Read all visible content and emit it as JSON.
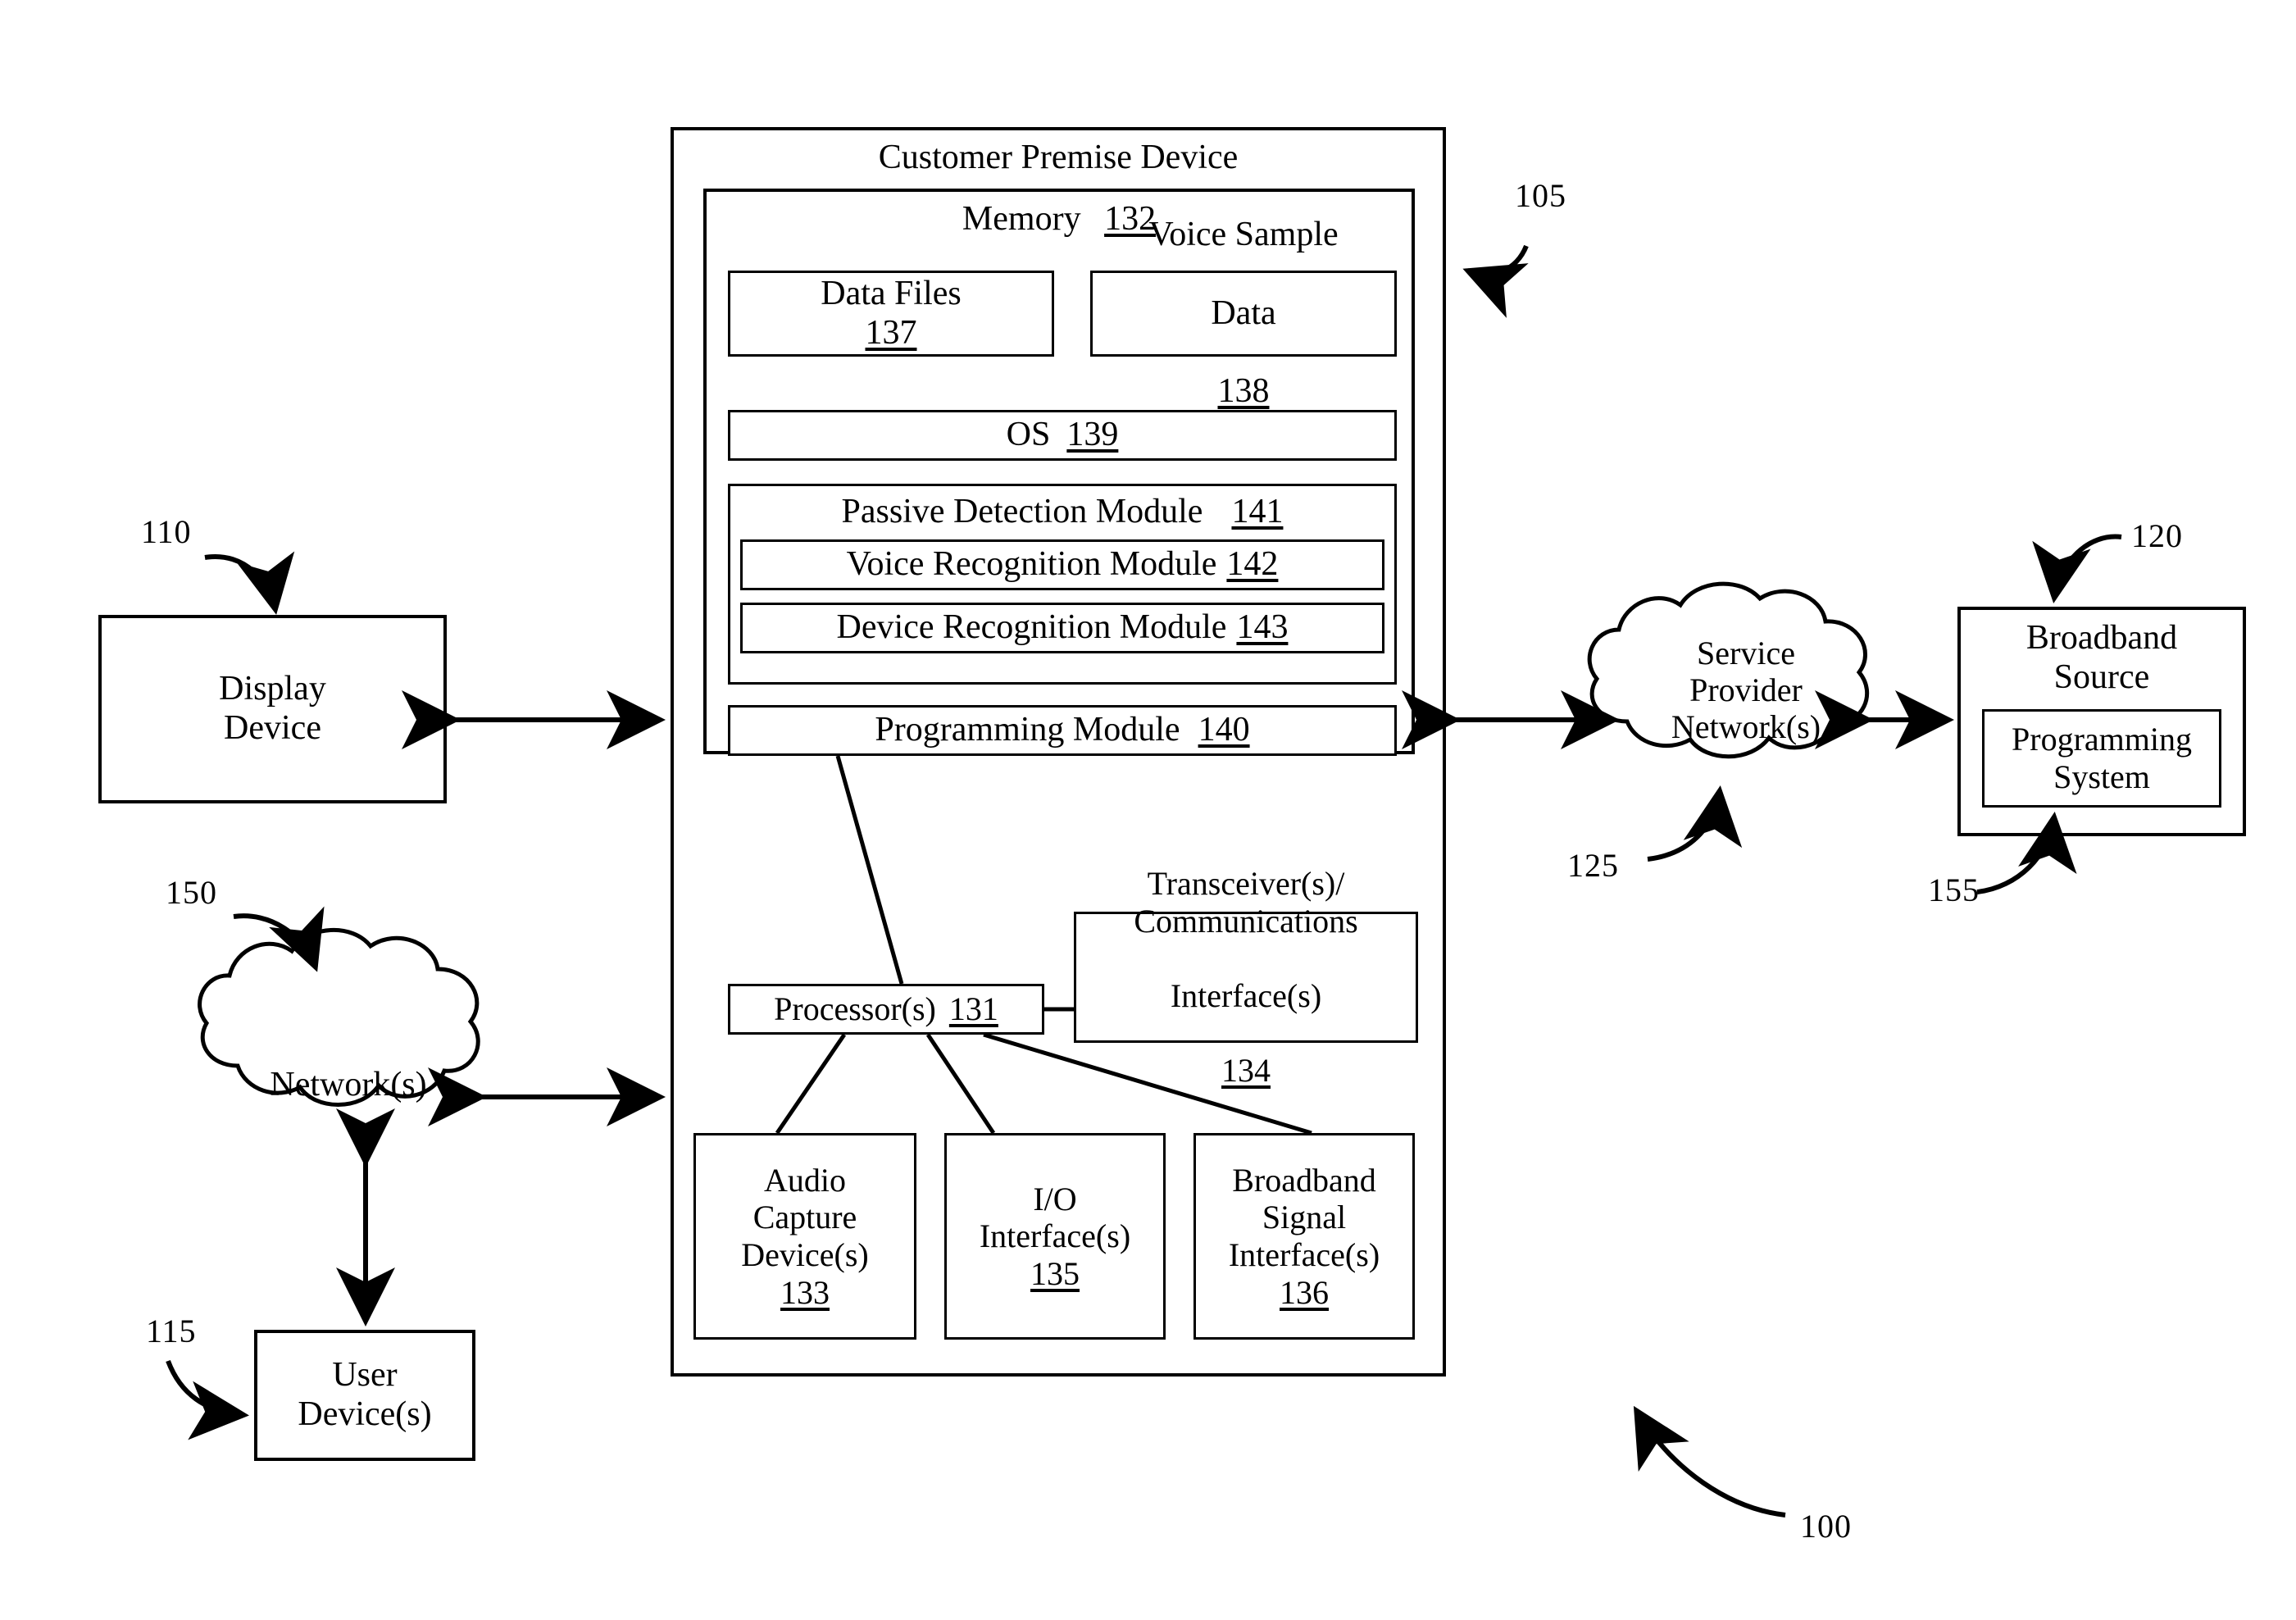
{
  "figure": {
    "system_ref": "100",
    "cpe": {
      "title": "Customer Premise Device",
      "ref": "105",
      "memory": {
        "label": "Memory",
        "ref": "132",
        "data_files": {
          "label": "Data Files",
          "ref": "137"
        },
        "voice_sample_data": {
          "label": "Voice Sample\nData",
          "ref": "138"
        },
        "os": {
          "label": "OS",
          "ref": "139"
        },
        "passive_detection": {
          "label": "Passive Detection Module",
          "ref": "141"
        },
        "voice_recognition": {
          "label": "Voice Recognition Module",
          "ref": "142"
        },
        "device_recognition": {
          "label": "Device Recognition Module",
          "ref": "143"
        },
        "programming_module": {
          "label": "Programming Module",
          "ref": "140"
        }
      },
      "processor": {
        "label": "Processor(s)",
        "ref": "131"
      },
      "transceiver": {
        "label": "Transceiver(s)/\nCommunications\nInterface(s)",
        "ref": "134"
      },
      "audio_capture": {
        "label": "Audio\nCapture\nDevice(s)",
        "ref": "133"
      },
      "io_interface": {
        "label": "I/O\nInterface(s)",
        "ref": "135"
      },
      "broadband_signal_interface": {
        "label": "Broadband\nSignal\nInterface(s)",
        "ref": "136"
      }
    },
    "display_device": {
      "label": "Display\nDevice",
      "ref": "110"
    },
    "networks_cloud": {
      "label": "Network(s)",
      "ref": "150"
    },
    "user_device": {
      "label": "User\nDevice(s)",
      "ref": "115"
    },
    "service_provider_cloud": {
      "label": "Service\nProvider\nNetwork(s)",
      "ref": "125"
    },
    "broadband_source": {
      "label": "Broadband\nSource",
      "ref": "120",
      "programming_system": {
        "label": "Programming\nSystem",
        "ref": "155"
      }
    }
  }
}
